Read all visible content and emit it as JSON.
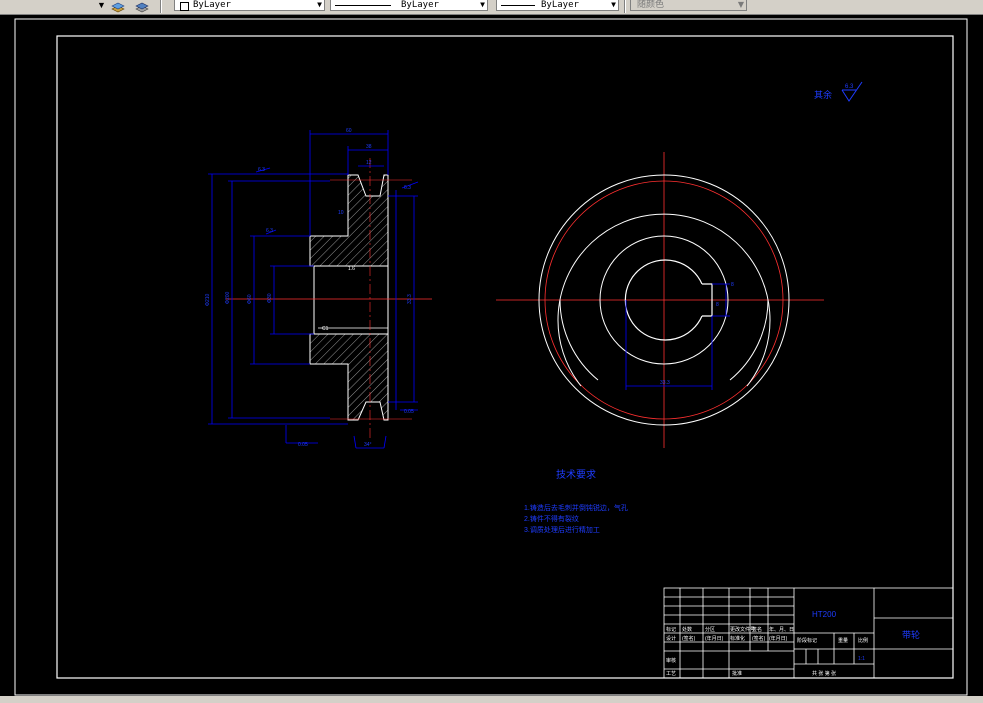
{
  "toolbar": {
    "layer_combo": {
      "value": "ByLayer"
    },
    "linetype_combo": {
      "value": "ByLayer"
    },
    "lineweight_combo": {
      "value": "ByLayer"
    },
    "plotstyle_combo": {
      "value": "随颜色"
    }
  },
  "drawing": {
    "roughness_label": "其余",
    "roughness_value": "6.3",
    "tech_title": "技术要求",
    "tech_items": [
      "1.铸造后去毛刺并倒钝锐边，气孔",
      "2.铸件不得有裂纹",
      "3.调质处理后进行精加工"
    ],
    "dim_labels": {
      "overall_width": "60",
      "hub_width": "38",
      "groove_top": "12",
      "groove_bottom": "10",
      "roughness_a": "6.3",
      "roughness_b": "6.3",
      "roughness_c": "6.3",
      "roughness_d": "1.6",
      "chamfer": "C1",
      "bore": "Φ30",
      "keyway": "8",
      "key_depth": "33.3",
      "outer_dia": "Φ210",
      "pitch_dia": "Φ200",
      "hub_dia": "Φ60",
      "angle": "34°",
      "runout_a": "0.05",
      "runout_b": "0.05",
      "slot": "8",
      "key_dim": "33.3"
    }
  },
  "title_block": {
    "material": "HT200",
    "part_name": "带轮",
    "headers": [
      "标记",
      "处数",
      "分区",
      "更改文件号",
      "签名",
      "年、月、日"
    ],
    "row_design": [
      "设计",
      "(签名)",
      "(年月日)",
      "标准化",
      "(签名)",
      "(年月日)"
    ],
    "stage_label": "阶段标记",
    "weight_label": "重量",
    "scale_label": "比例",
    "scale_value": "1:1",
    "review_label": "审核",
    "process_label": "工艺",
    "approve_label": "批准",
    "sheet_text": "共  张  第  张"
  },
  "colors": {
    "background": "#000000",
    "line": "#ffffff",
    "dimension": "#0000ff",
    "centerline": "#ff0000",
    "hatch": "#ffffff",
    "text_blue": "#1e3cff"
  }
}
